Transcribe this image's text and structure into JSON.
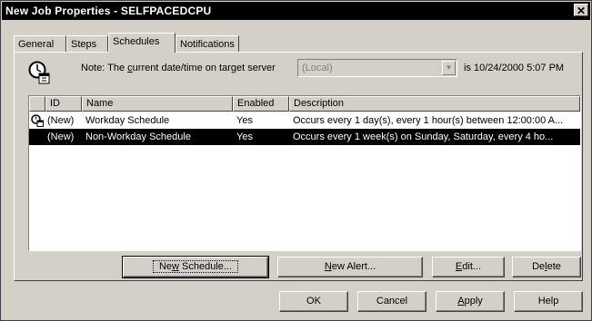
{
  "window": {
    "title": "New Job Properties - SELFPACEDCPU",
    "close_glyph": "✕"
  },
  "tabs": [
    {
      "label": "General",
      "active": false
    },
    {
      "label": "Steps",
      "active": false
    },
    {
      "label": "Schedules",
      "active": true
    },
    {
      "label": "Notifications",
      "active": false
    }
  ],
  "note": {
    "prefix": "Note: The ",
    "accel": "c",
    "suffix": "urrent date/time on target server",
    "server_value": "(Local)",
    "date_label": "is 10/24/2000 5:07 PM"
  },
  "list": {
    "columns": [
      "ID",
      "Name",
      "Enabled",
      "Description"
    ],
    "rows": [
      {
        "id": "(New)",
        "name": "Workday Schedule",
        "enabled": "Yes",
        "description": "Occurs every 1 day(s), every 1 hour(s) between 12:00:00 A...",
        "selected": false
      },
      {
        "id": "(New)",
        "name": "Non-Workday Schedule",
        "enabled": "Yes",
        "description": "Occurs every 1 week(s) on Sunday, Saturday, every 4 ho...",
        "selected": true
      }
    ]
  },
  "list_buttons": {
    "new_schedule": {
      "pre": "Ne",
      "accel": "w",
      "post": " Schedule..."
    },
    "new_alert": {
      "pre": "",
      "accel": "N",
      "post": "ew Alert..."
    },
    "edit": {
      "pre": "",
      "accel": "E",
      "post": "dit..."
    },
    "delete": {
      "pre": "De",
      "accel": "l",
      "post": "ete"
    }
  },
  "dialog_buttons": {
    "ok": "OK",
    "cancel": "Cancel",
    "apply": {
      "pre": "",
      "accel": "A",
      "post": "pply"
    },
    "help": "Help"
  },
  "colors": {
    "face": "#d4d0c8",
    "selection": "#000000",
    "disabled_text": "#808080"
  }
}
